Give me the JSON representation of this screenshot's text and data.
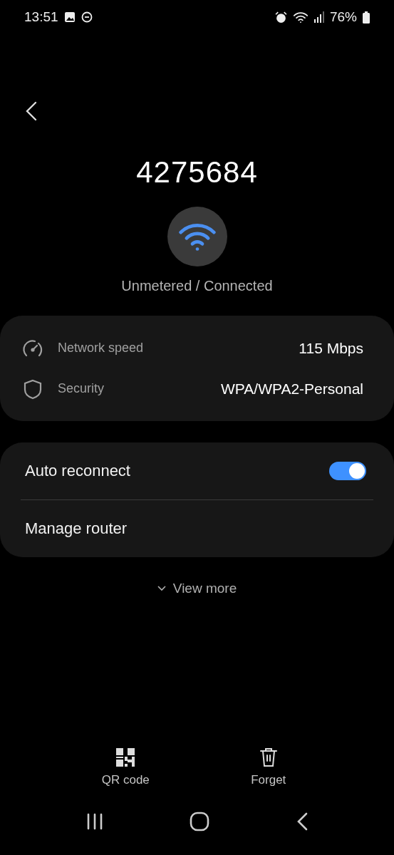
{
  "status_bar": {
    "time": "13:51",
    "battery": "76%"
  },
  "network": {
    "name": "4275684",
    "status": "Unmetered / Connected"
  },
  "details": [
    {
      "kind": "speed",
      "label": "Network speed",
      "value": "115 Mbps"
    },
    {
      "kind": "security",
      "label": "Security",
      "value": "WPA/WPA2-Personal"
    }
  ],
  "settings": [
    {
      "kind": "toggle",
      "label": "Auto reconnect",
      "on": true
    },
    {
      "kind": "link",
      "label": "Manage router"
    }
  ],
  "view_more": "View more",
  "actions": [
    {
      "kind": "qr",
      "label": "QR code"
    },
    {
      "kind": "forget",
      "label": "Forget"
    }
  ]
}
